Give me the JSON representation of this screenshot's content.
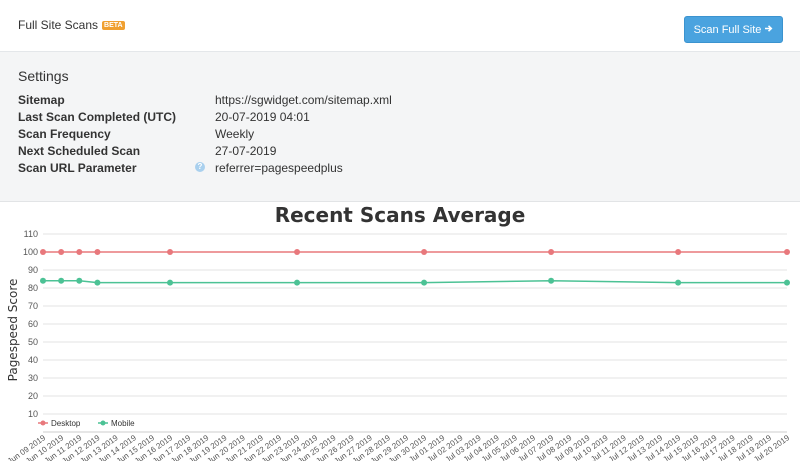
{
  "header": {
    "title": "Full Site Scans",
    "beta_badge": "BETA",
    "scan_button_label": "Scan Full Site",
    "scan_button_icon": "arrow-right-icon"
  },
  "settings": {
    "heading": "Settings",
    "rows": [
      {
        "label": "Sitemap",
        "value": "https://sgwidget.com/sitemap.xml"
      },
      {
        "label": "Last Scan Completed (UTC)",
        "value": "20-07-2019 04:01"
      },
      {
        "label": "Scan Frequency",
        "value": "Weekly"
      },
      {
        "label": "Next Scheduled Scan",
        "value": "27-07-2019"
      },
      {
        "label": "Scan URL Parameter",
        "value": "referrer=pagespeedplus"
      }
    ],
    "help_icon": "question-circle-icon",
    "help_icon_glyph": "?"
  },
  "chart_data": {
    "type": "line",
    "title": "Recent Scans Average",
    "xlabel": "",
    "ylabel": "Pagespeed Score",
    "ylim": [
      0,
      110
    ],
    "yticks": [
      10,
      20,
      30,
      40,
      50,
      60,
      70,
      80,
      90,
      100,
      110
    ],
    "grid": true,
    "legend_placement": "bottom-left",
    "categories": [
      "Jun 09 2019",
      "Jun 10 2019",
      "Jun 11 2019",
      "Jun 12 2019",
      "Jun 13 2019",
      "Jun 14 2019",
      "Jun 15 2019",
      "Jun 16 2019",
      "Jun 17 2019",
      "Jun 18 2019",
      "Jun 19 2019",
      "Jun 20 2019",
      "Jun 21 2019",
      "Jun 22 2019",
      "Jun 23 2019",
      "Jun 24 2019",
      "Jun 25 2019",
      "Jun 26 2019",
      "Jun 27 2019",
      "Jun 28 2019",
      "Jun 29 2019",
      "Jun 30 2019",
      "Jul 01 2019",
      "Jul 02 2019",
      "Jul 03 2019",
      "Jul 04 2019",
      "Jul 05 2019",
      "Jul 06 2019",
      "Jul 07 2019",
      "Jul 08 2019",
      "Jul 09 2019",
      "Jul 10 2019",
      "Jul 11 2019",
      "Jul 12 2019",
      "Jul 13 2019",
      "Jul 14 2019",
      "Jul 15 2019",
      "Jul 16 2019",
      "Jul 17 2019",
      "Jul 18 2019",
      "Jul 19 2019",
      "Jul 20 2019"
    ],
    "series": [
      {
        "name": "Desktop",
        "color": "#e8787c",
        "points": [
          {
            "x": "Jun 09 2019",
            "y": 100
          },
          {
            "x": "Jun 10 2019",
            "y": 100
          },
          {
            "x": "Jun 11 2019",
            "y": 100
          },
          {
            "x": "Jun 12 2019",
            "y": 100
          },
          {
            "x": "Jun 16 2019",
            "y": 100
          },
          {
            "x": "Jun 23 2019",
            "y": 100
          },
          {
            "x": "Jun 30 2019",
            "y": 100
          },
          {
            "x": "Jul 07 2019",
            "y": 100
          },
          {
            "x": "Jul 14 2019",
            "y": 100
          },
          {
            "x": "Jul 20 2019",
            "y": 100
          }
        ]
      },
      {
        "name": "Mobile",
        "color": "#4cc295",
        "points": [
          {
            "x": "Jun 09 2019",
            "y": 84
          },
          {
            "x": "Jun 10 2019",
            "y": 84
          },
          {
            "x": "Jun 11 2019",
            "y": 84
          },
          {
            "x": "Jun 12 2019",
            "y": 83
          },
          {
            "x": "Jun 16 2019",
            "y": 83
          },
          {
            "x": "Jun 23 2019",
            "y": 83
          },
          {
            "x": "Jun 30 2019",
            "y": 83
          },
          {
            "x": "Jul 07 2019",
            "y": 84
          },
          {
            "x": "Jul 14 2019",
            "y": 83
          },
          {
            "x": "Jul 20 2019",
            "y": 83
          }
        ]
      }
    ]
  }
}
